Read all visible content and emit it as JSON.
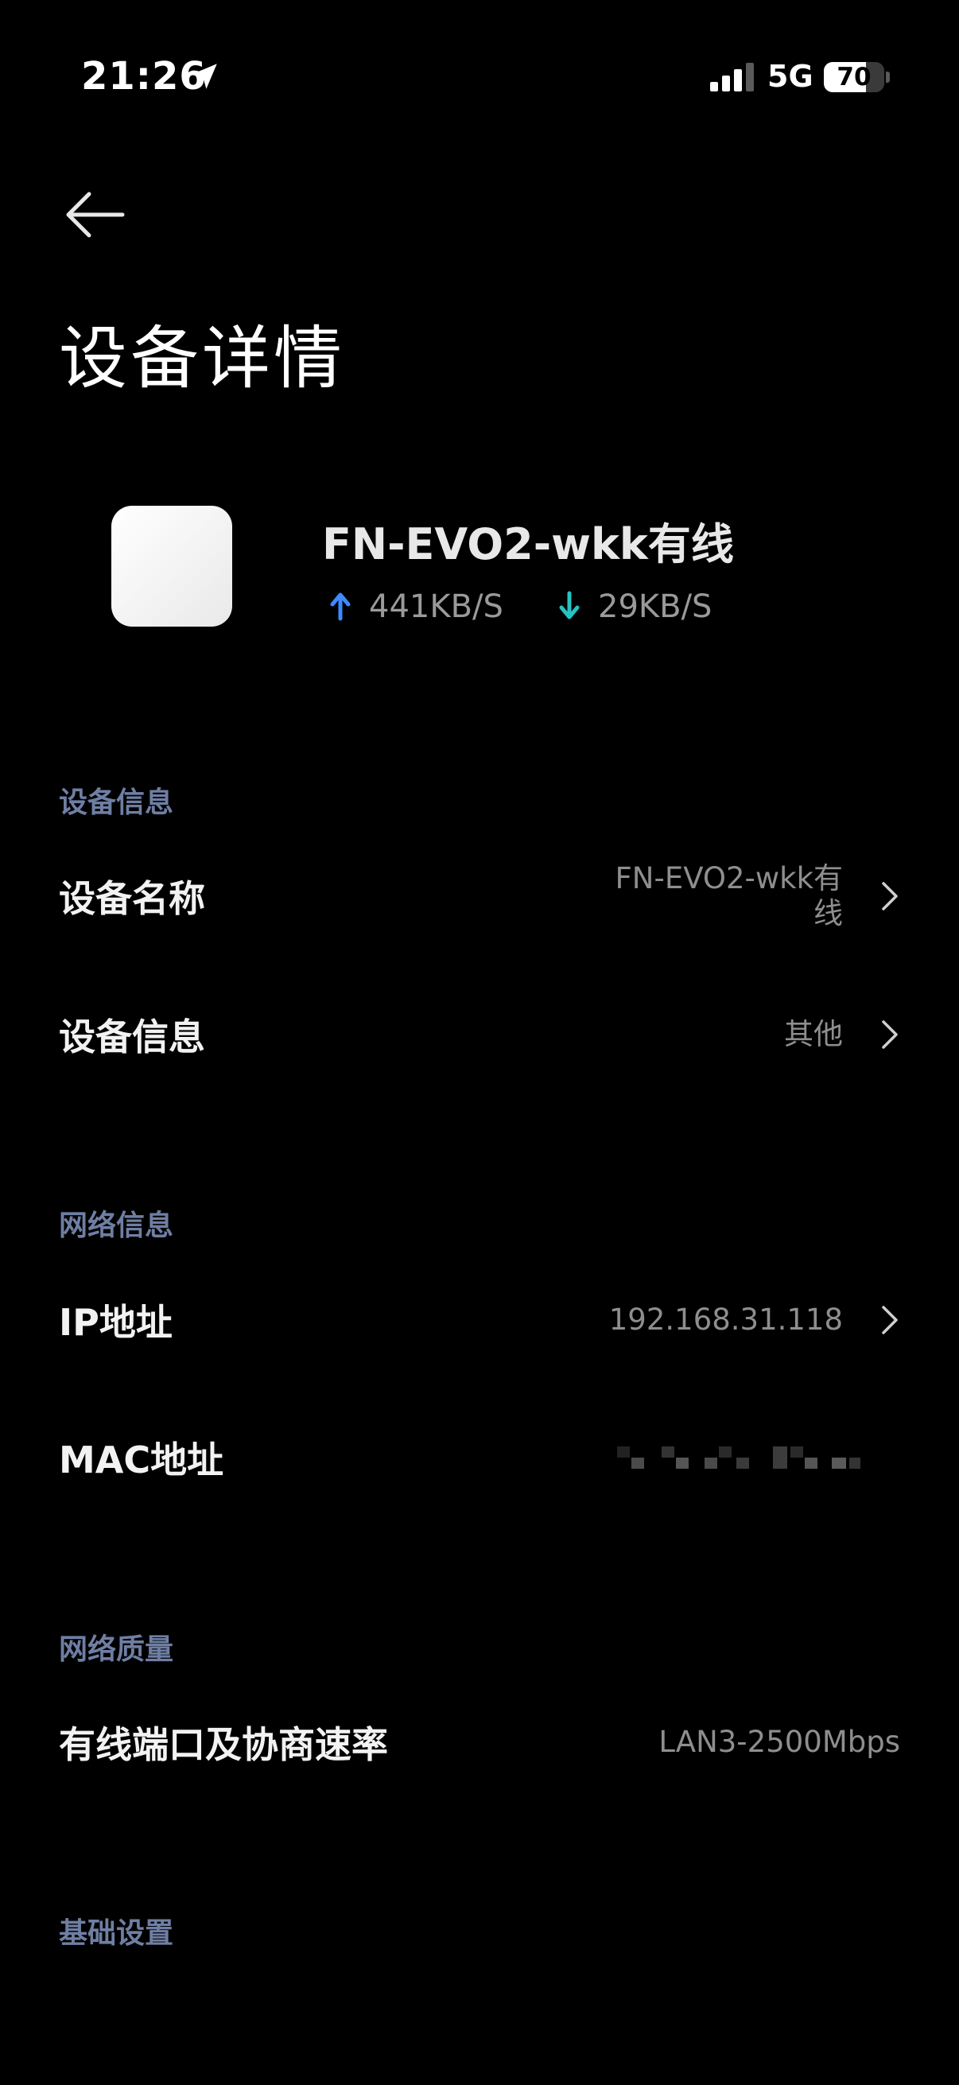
{
  "status_bar": {
    "time": "21:26",
    "network": "5G",
    "battery_level": 70,
    "battery_text": "70",
    "location_icon": "location-arrow-icon",
    "signal_icon": "cellular-signal-icon"
  },
  "header": {
    "back_icon": "back-arrow-icon",
    "title": "设备详情"
  },
  "device": {
    "name": "FN-EVO2-wkk有线",
    "upload_speed": "441KB/S",
    "download_speed": "29KB/S",
    "upload_color": "#3d8bff",
    "download_color": "#27c2c2"
  },
  "sections": {
    "device_info": {
      "label": "设备信息",
      "device_name_label": "设备名称",
      "device_name_value": "FN-EVO2-wkk有线",
      "device_info_label": "设备信息",
      "device_info_value": "其他"
    },
    "network_info": {
      "label": "网络信息",
      "ip_label": "IP地址",
      "ip_value": "192.168.31.118",
      "mac_label": "MAC地址"
    },
    "network_quality": {
      "label": "网络质量",
      "port_label": "有线端口及协商速率",
      "port_value": "LAN3-2500Mbps"
    },
    "basic_settings": {
      "label": "基础设置"
    }
  },
  "colors": {
    "background": "#000000",
    "section_label": "#6f7ea3",
    "value_text": "#8e8e8e"
  }
}
